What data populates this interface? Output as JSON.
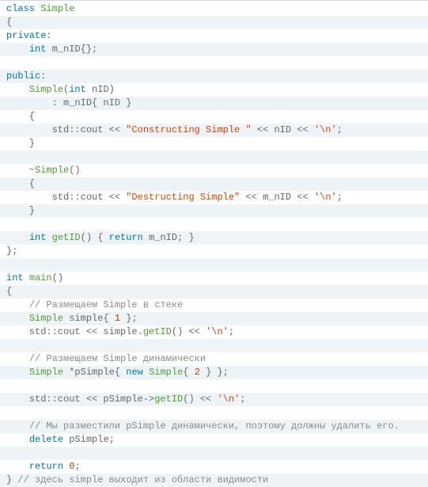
{
  "code": {
    "tokens": [
      [
        [
          "kw-blue",
          "class"
        ],
        [
          "",
          ""
        ],
        [
          "",
          " "
        ],
        [
          "cls-green",
          "Simple"
        ]
      ],
      [
        [
          "",
          "{"
        ]
      ],
      [
        [
          "kw-blue",
          "private"
        ],
        [
          "",
          ":"
        ]
      ],
      [
        [
          "",
          "    "
        ],
        [
          "kw-blue",
          "int"
        ],
        [
          "",
          " m_nID{};"
        ]
      ],
      [
        [
          "",
          ""
        ]
      ],
      [
        [
          "kw-blue",
          "public"
        ],
        [
          "",
          ":"
        ]
      ],
      [
        [
          "",
          "    "
        ],
        [
          "cls-green",
          "Simple"
        ],
        [
          "",
          "("
        ],
        [
          "kw-blue",
          "int"
        ],
        [
          "",
          " nID)"
        ]
      ],
      [
        [
          "",
          "        : m_nID{ nID }"
        ]
      ],
      [
        [
          "",
          "    {"
        ]
      ],
      [
        [
          "",
          "        std::cout << "
        ],
        [
          "string",
          "\"Constructing Simple \""
        ],
        [
          "",
          " << nID << "
        ],
        [
          "char",
          "'\\n'"
        ],
        [
          "",
          ";"
        ]
      ],
      [
        [
          "",
          "    }"
        ]
      ],
      [
        [
          "",
          ""
        ]
      ],
      [
        [
          "",
          "    ~"
        ],
        [
          "cls-green",
          "Simple"
        ],
        [
          "",
          "()"
        ]
      ],
      [
        [
          "",
          "    {"
        ]
      ],
      [
        [
          "",
          "        std::cout << "
        ],
        [
          "string",
          "\"Destructing Simple\""
        ],
        [
          "",
          " << m_nID << "
        ],
        [
          "char",
          "'\\n'"
        ],
        [
          "",
          ";"
        ]
      ],
      [
        [
          "",
          "    }"
        ]
      ],
      [
        [
          "",
          ""
        ]
      ],
      [
        [
          "",
          "    "
        ],
        [
          "kw-blue",
          "int"
        ],
        [
          "",
          " "
        ],
        [
          "cls-green",
          "getID"
        ],
        [
          "",
          "() { "
        ],
        [
          "kw-blue",
          "return"
        ],
        [
          "",
          " m_nID; }"
        ]
      ],
      [
        [
          "",
          "};"
        ]
      ],
      [
        [
          "",
          ""
        ]
      ],
      [
        [
          "kw-blue",
          "int"
        ],
        [
          "",
          " "
        ],
        [
          "cls-green",
          "main"
        ],
        [
          "",
          "()"
        ]
      ],
      [
        [
          "",
          "{"
        ]
      ],
      [
        [
          "",
          "    "
        ],
        [
          "comment",
          "// Размещаем Simple в стеке"
        ]
      ],
      [
        [
          "",
          "    "
        ],
        [
          "cls-green",
          "Simple"
        ],
        [
          "",
          " simple{ "
        ],
        [
          "number",
          "1"
        ],
        [
          "",
          " };"
        ]
      ],
      [
        [
          "",
          "    std::cout << simple."
        ],
        [
          "cls-green",
          "getID"
        ],
        [
          "",
          "() << "
        ],
        [
          "char",
          "'\\n'"
        ],
        [
          "",
          ";"
        ]
      ],
      [
        [
          "",
          ""
        ]
      ],
      [
        [
          "",
          "    "
        ],
        [
          "comment",
          "// Размещаем Simple динамически"
        ]
      ],
      [
        [
          "",
          "    "
        ],
        [
          "cls-green",
          "Simple"
        ],
        [
          "",
          " *pSimple{ "
        ],
        [
          "kw-blue",
          "new"
        ],
        [
          "",
          " "
        ],
        [
          "cls-green",
          "Simple"
        ],
        [
          "",
          "{ "
        ],
        [
          "number",
          "2"
        ],
        [
          "",
          " } };"
        ]
      ],
      [
        [
          "",
          ""
        ]
      ],
      [
        [
          "",
          "    std::cout << pSimple->"
        ],
        [
          "cls-green",
          "getID"
        ],
        [
          "",
          "() << "
        ],
        [
          "char",
          "'\\n'"
        ],
        [
          "",
          ";"
        ]
      ],
      [
        [
          "",
          ""
        ]
      ],
      [
        [
          "",
          "    "
        ],
        [
          "comment",
          "// Мы разместили pSimple динамически, поэтому должны удалить его."
        ]
      ],
      [
        [
          "",
          "    "
        ],
        [
          "kw-blue",
          "delete"
        ],
        [
          "",
          " pSimple;"
        ]
      ],
      [
        [
          "",
          ""
        ]
      ],
      [
        [
          "",
          "    "
        ],
        [
          "kw-blue",
          "return"
        ],
        [
          "",
          " "
        ],
        [
          "number",
          "0"
        ],
        [
          "",
          ";"
        ]
      ],
      [
        [
          "",
          "} "
        ],
        [
          "comment",
          "// здесь simple выходит из области видимости"
        ]
      ]
    ]
  }
}
